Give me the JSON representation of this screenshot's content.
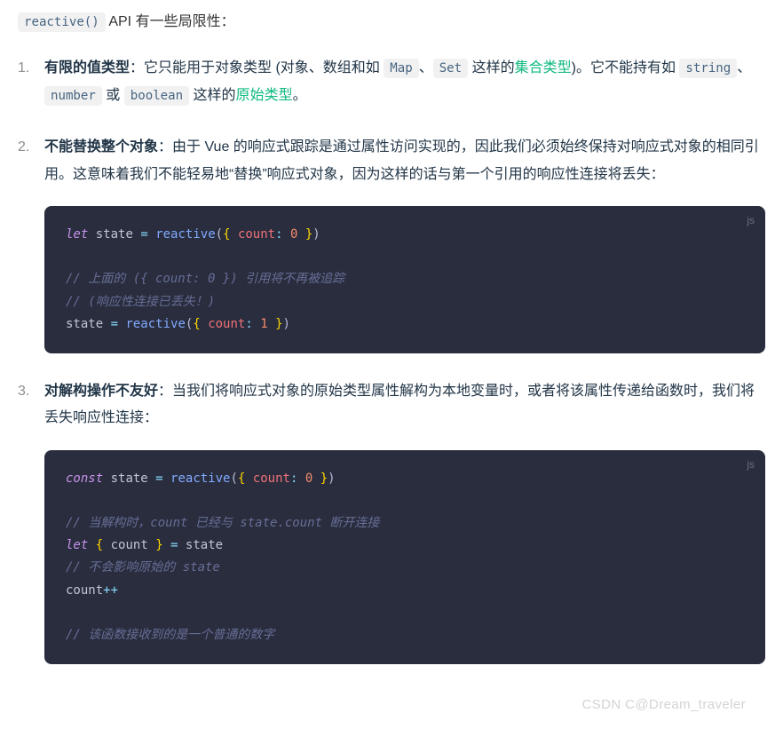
{
  "intro": {
    "code": "reactive()",
    "text": " API 有一些局限性："
  },
  "items": [
    {
      "title": "有限的值类型",
      "body_parts": [
        {
          "t": "text",
          "v": "：它只能用于对象类型 (对象、数组和如 "
        },
        {
          "t": "code",
          "v": "Map"
        },
        {
          "t": "text",
          "v": "、"
        },
        {
          "t": "code",
          "v": "Set"
        },
        {
          "t": "text",
          "v": " 这样的"
        },
        {
          "t": "link",
          "v": "集合类型"
        },
        {
          "t": "text",
          "v": ")。它不能持有如 "
        },
        {
          "t": "code",
          "v": "string"
        },
        {
          "t": "text",
          "v": "、"
        },
        {
          "t": "code",
          "v": "number"
        },
        {
          "t": "text",
          "v": " 或 "
        },
        {
          "t": "code",
          "v": "boolean"
        },
        {
          "t": "text",
          "v": " 这样的"
        },
        {
          "t": "link",
          "v": "原始类型"
        },
        {
          "t": "text",
          "v": "。"
        }
      ]
    },
    {
      "title": "不能替换整个对象",
      "body_parts": [
        {
          "t": "text",
          "v": "：由于 Vue 的响应式跟踪是通过属性访问实现的，因此我们必须始终保持对响应式对象的相同引用。这意味着我们不能轻易地“替换”响应式对象，因为这样的话与第一个引用的响应性连接将丢失："
        }
      ],
      "code": {
        "lang": "js",
        "lines": [
          [
            {
              "c": "kw",
              "v": "let"
            },
            {
              "c": "var",
              "v": " state "
            },
            {
              "c": "op",
              "v": "="
            },
            {
              "c": "var",
              "v": " "
            },
            {
              "c": "fn",
              "v": "reactive"
            },
            {
              "c": "p",
              "v": "("
            },
            {
              "c": "br",
              "v": "{"
            },
            {
              "c": "var",
              "v": " "
            },
            {
              "c": "prop",
              "v": "count"
            },
            {
              "c": "op",
              "v": ":"
            },
            {
              "c": "var",
              "v": " "
            },
            {
              "c": "num",
              "v": "0"
            },
            {
              "c": "var",
              "v": " "
            },
            {
              "c": "br",
              "v": "}"
            },
            {
              "c": "p",
              "v": ")"
            }
          ],
          [],
          [
            {
              "c": "cm",
              "v": "// 上面的 ({ count: 0 }) 引用将不再被追踪"
            }
          ],
          [
            {
              "c": "cm",
              "v": "// (响应性连接已丢失！)"
            }
          ],
          [
            {
              "c": "var",
              "v": "state "
            },
            {
              "c": "op",
              "v": "="
            },
            {
              "c": "var",
              "v": " "
            },
            {
              "c": "fn",
              "v": "reactive"
            },
            {
              "c": "p",
              "v": "("
            },
            {
              "c": "br",
              "v": "{"
            },
            {
              "c": "var",
              "v": " "
            },
            {
              "c": "prop",
              "v": "count"
            },
            {
              "c": "op",
              "v": ":"
            },
            {
              "c": "var",
              "v": " "
            },
            {
              "c": "num",
              "v": "1"
            },
            {
              "c": "var",
              "v": " "
            },
            {
              "c": "br",
              "v": "}"
            },
            {
              "c": "p",
              "v": ")"
            }
          ]
        ]
      }
    },
    {
      "title": "对解构操作不友好",
      "body_parts": [
        {
          "t": "text",
          "v": "：当我们将响应式对象的原始类型属性解构为本地变量时，或者将该属性传递给函数时，我们将丢失响应性连接："
        }
      ],
      "code": {
        "lang": "js",
        "lines": [
          [
            {
              "c": "kw",
              "v": "const"
            },
            {
              "c": "var",
              "v": " state "
            },
            {
              "c": "op",
              "v": "="
            },
            {
              "c": "var",
              "v": " "
            },
            {
              "c": "fn",
              "v": "reactive"
            },
            {
              "c": "p",
              "v": "("
            },
            {
              "c": "br",
              "v": "{"
            },
            {
              "c": "var",
              "v": " "
            },
            {
              "c": "prop",
              "v": "count"
            },
            {
              "c": "op",
              "v": ":"
            },
            {
              "c": "var",
              "v": " "
            },
            {
              "c": "num",
              "v": "0"
            },
            {
              "c": "var",
              "v": " "
            },
            {
              "c": "br",
              "v": "}"
            },
            {
              "c": "p",
              "v": ")"
            }
          ],
          [],
          [
            {
              "c": "cm",
              "v": "// 当解构时，count 已经与 state.count 断开连接"
            }
          ],
          [
            {
              "c": "kw",
              "v": "let"
            },
            {
              "c": "var",
              "v": " "
            },
            {
              "c": "br",
              "v": "{"
            },
            {
              "c": "var",
              "v": " count "
            },
            {
              "c": "br",
              "v": "}"
            },
            {
              "c": "var",
              "v": " "
            },
            {
              "c": "op",
              "v": "="
            },
            {
              "c": "var",
              "v": " state"
            }
          ],
          [
            {
              "c": "cm",
              "v": "// 不会影响原始的 state"
            }
          ],
          [
            {
              "c": "var",
              "v": "count"
            },
            {
              "c": "op",
              "v": "++"
            }
          ],
          [],
          [
            {
              "c": "cm",
              "v": "// 该函数接收到的是一个普通的数字"
            }
          ]
        ]
      }
    }
  ],
  "watermark": "CSDN C@Dream_traveler"
}
